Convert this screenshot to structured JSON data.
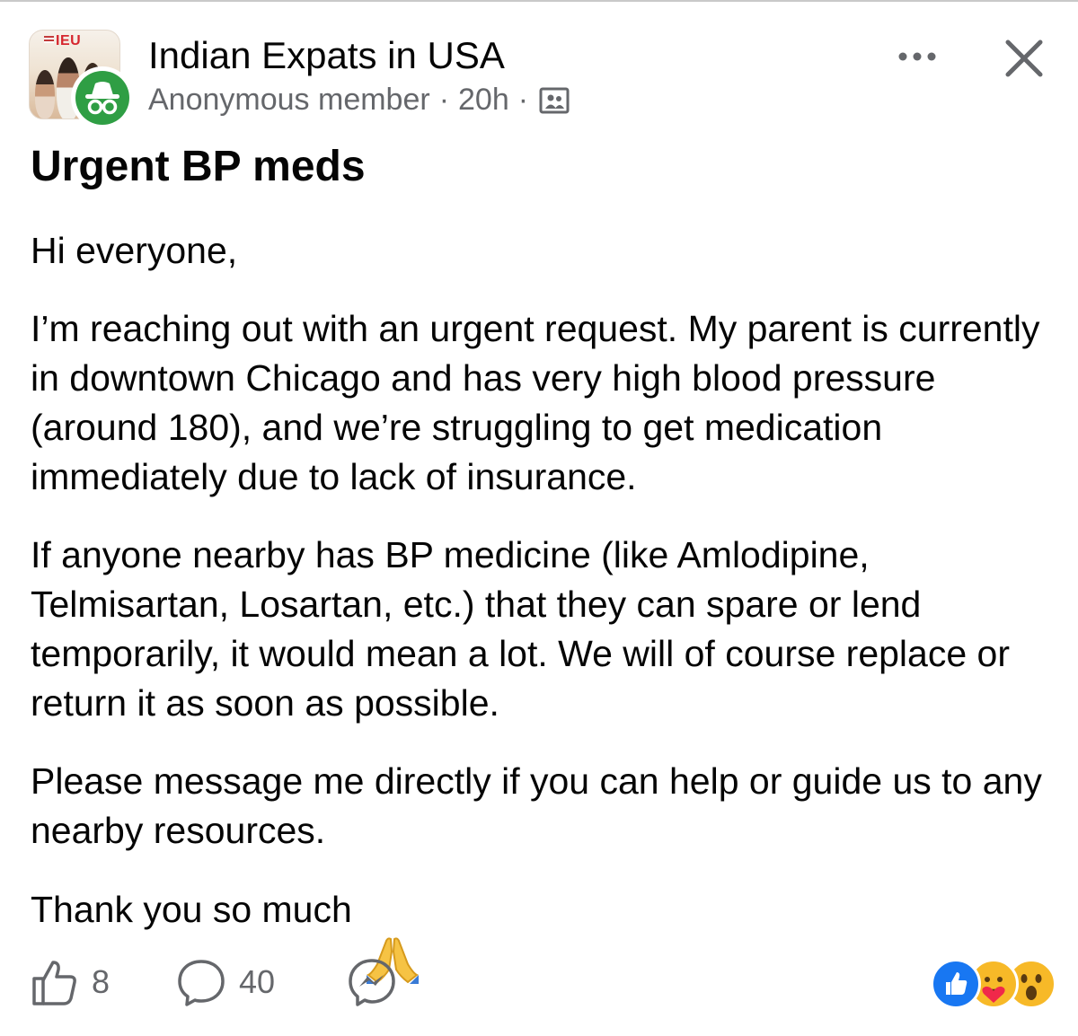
{
  "group": {
    "name": "Indian Expats in USA",
    "avatar_badge": "IEU",
    "author": "Anonymous member",
    "time": "20h",
    "separator": "·",
    "audience_icon": "group-members-icon"
  },
  "header_actions": {
    "more_icon": "more-horizontal-icon",
    "close_icon": "close-icon"
  },
  "post": {
    "title": "Urgent BP meds",
    "paragraphs": [
      "Hi everyone,",
      "I’m reaching out with an urgent request. My parent is currently in downtown Chicago and has very high blood pressure (around 180), and we’re struggling to get medication immediately due to lack of insurance.",
      "If anyone nearby has BP medicine (like Amlodipine, Telmisartan, Losartan, etc.) that they can spare or lend temporarily, it would mean a lot. We will of course replace or return it as soon as possible.",
      "Please message me directly if you can help or guide us to any nearby resources.",
      "Thank you so much"
    ],
    "closing_emoji": "folded-hands-icon"
  },
  "footer": {
    "like_count": "8",
    "comment_count": "40",
    "like_icon": "thumbs-up-icon",
    "comment_icon": "comment-bubble-icon",
    "share_icon": "messenger-icon",
    "reactions": [
      "like-reaction-icon",
      "care-reaction-icon",
      "wow-reaction-icon"
    ]
  },
  "colors": {
    "text_primary": "#050505",
    "text_secondary": "#65676b",
    "like_blue": "#1877f2",
    "anon_green": "#2f9e44",
    "reaction_yellow": "#f7b928"
  }
}
